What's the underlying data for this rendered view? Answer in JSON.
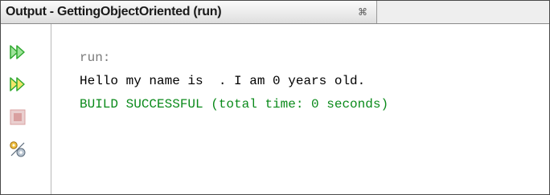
{
  "tab": {
    "title": "Output - GettingObjectOriented (run)",
    "close_glyph": "⌘"
  },
  "toolbar": {
    "buttons": [
      {
        "icon": "rerun-icon"
      },
      {
        "icon": "rerun-with-options-icon"
      },
      {
        "icon": "stop-icon"
      },
      {
        "icon": "settings-icon"
      }
    ]
  },
  "console": {
    "lines": [
      {
        "text": "run:",
        "color": "#7a7a7a"
      },
      {
        "text": "Hello my name is  . I am 0 years old.",
        "color": "#000000"
      },
      {
        "text": "BUILD SUCCESSFUL (total time: 0 seconds)",
        "color": "#0a8a1a"
      }
    ]
  },
  "colors": {
    "accent_green": "#2fa82f",
    "build_success": "#0a8a1a",
    "stop_red": "#d9a0a0"
  }
}
